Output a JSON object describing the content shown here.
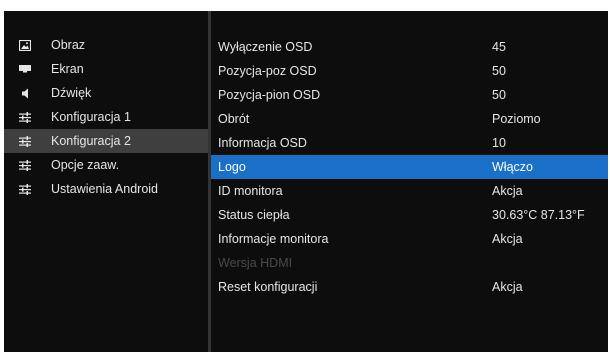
{
  "menu": {
    "items": [
      {
        "label": "Obraz",
        "icon": "image-icon",
        "active": false
      },
      {
        "label": "Ekran",
        "icon": "monitor-icon",
        "active": false
      },
      {
        "label": "Dźwięk",
        "icon": "speaker-icon",
        "active": false
      },
      {
        "label": "Konfiguracja 1",
        "icon": "sliders-icon",
        "active": false
      },
      {
        "label": "Konfiguracja 2",
        "icon": "sliders-icon",
        "active": true
      },
      {
        "label": "Opcje zaaw.",
        "icon": "sliders-icon",
        "active": false
      },
      {
        "label": "Ustawienia Android",
        "icon": "sliders-icon",
        "active": false
      }
    ]
  },
  "settings": {
    "rows": [
      {
        "label": "Wyłączenie OSD",
        "value": "45"
      },
      {
        "label": "Pozycja-poz OSD",
        "value": "50"
      },
      {
        "label": "Pozycja-pion OSD",
        "value": "50"
      },
      {
        "label": "Obrót",
        "value": "Poziomo"
      },
      {
        "label": "Informacja OSD",
        "value": "10"
      },
      {
        "label": "Logo",
        "value": "Włączo"
      },
      {
        "label": "ID monitora",
        "value": "Akcja"
      },
      {
        "label": "Status ciepła",
        "value": "30.63°C 87.13°F"
      },
      {
        "label": "Informacje monitora",
        "value": "Akcja"
      },
      {
        "label": "Wersja HDMI",
        "value": ""
      },
      {
        "label": "Reset konfiguracji",
        "value": "Akcja"
      }
    ]
  },
  "colors": {
    "panel_background": "#0d0d0d",
    "active_menu_background": "#3f3f3f",
    "selected_row_background": "#1a6fc7",
    "divider": "#353535",
    "text": "#e6e6e6",
    "disabled_text": "#4a4a4a"
  }
}
